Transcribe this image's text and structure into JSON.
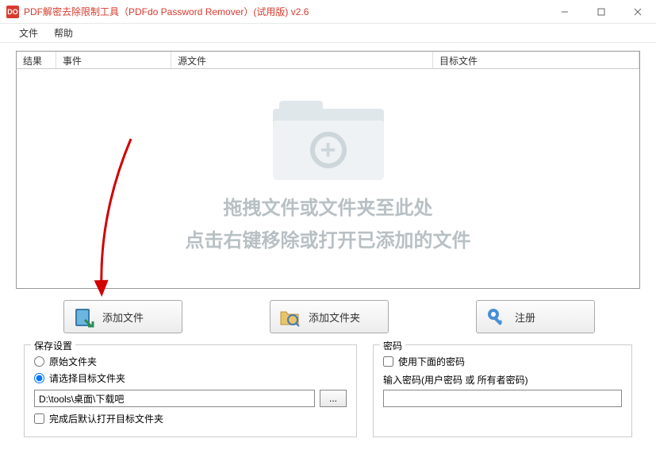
{
  "window": {
    "title": "PDF解密去除限制工具（PDFdo Password Remover）(试用版) v2.6",
    "icon_text": "DO"
  },
  "menu": {
    "file": "文件",
    "help": "帮助"
  },
  "columns": {
    "result": "结果",
    "event": "事件",
    "source": "源文件",
    "target": "目标文件"
  },
  "dropzone": {
    "line1": "拖拽文件或文件夹至此处",
    "line2": "点击右键移除或打开已添加的文件"
  },
  "buttons": {
    "add_file": "添加文件",
    "add_folder": "添加文件夹",
    "register": "注册"
  },
  "save_settings": {
    "legend": "保存设置",
    "original_folder": "原始文件夹",
    "choose_target": "请选择目标文件夹",
    "path_value": "D:\\tools\\桌面\\下载吧",
    "browse": "...",
    "open_after": "完成后默认打开目标文件夹"
  },
  "password": {
    "legend": "密码",
    "use_below": "使用下面的密码",
    "input_label": "输入密码(用户密码 或 所有者密码)"
  }
}
